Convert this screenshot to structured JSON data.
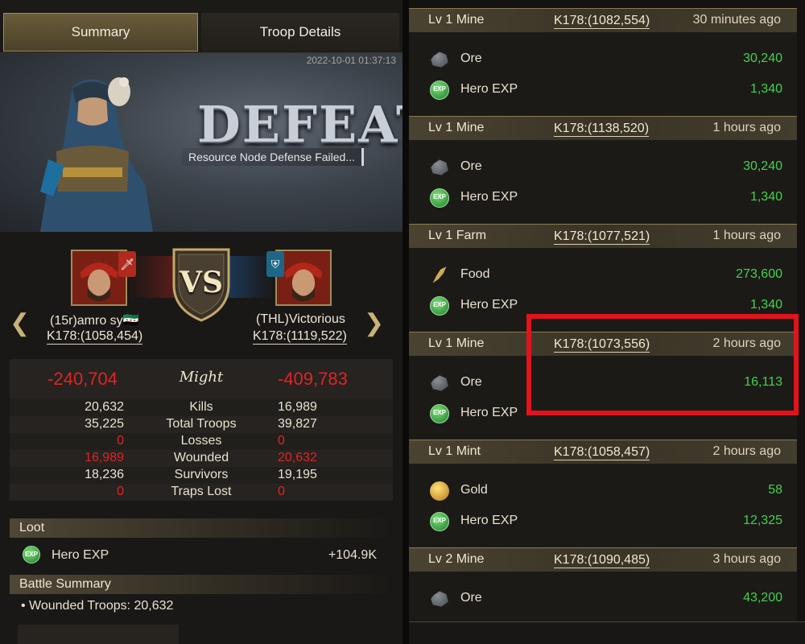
{
  "left": {
    "tabs": {
      "summary": "Summary",
      "troop_details": "Troop Details"
    },
    "timestamp": "2022-10-01 01:37:13",
    "banner": {
      "title": "DEFEAT",
      "subtitle": "Resource Node Defense Failed..."
    },
    "vs_label": "VS",
    "attacker": {
      "name": "(15r)amro sy🇸🇾",
      "coords": "K178:(1058,454)"
    },
    "defender": {
      "name": "(THL)Victorious",
      "coords": "K178:(1119,522)"
    },
    "might": {
      "label": "Might",
      "left": "-240,704",
      "right": "-409,783"
    },
    "stats": [
      {
        "label": "Kills",
        "left": "20,632",
        "right": "16,989",
        "left_red": false,
        "right_red": false
      },
      {
        "label": "Total Troops",
        "left": "35,225",
        "right": "39,827",
        "left_red": false,
        "right_red": false
      },
      {
        "label": "Losses",
        "left": "0",
        "right": "0",
        "left_red": true,
        "right_red": true
      },
      {
        "label": "Wounded",
        "left": "16,989",
        "right": "20,632",
        "left_red": true,
        "right_red": true
      },
      {
        "label": "Survivors",
        "left": "18,236",
        "right": "19,195",
        "left_red": false,
        "right_red": false
      },
      {
        "label": "Traps Lost",
        "left": "0",
        "right": "0",
        "left_red": true,
        "right_red": true
      }
    ],
    "loot": {
      "header": "Loot",
      "item_label": "Hero EXP",
      "item_value": "+104.9K"
    },
    "battle_summary": {
      "header": "Battle Summary",
      "line": "Wounded Troops: 20,632"
    }
  },
  "right": {
    "reports": [
      {
        "title": "Lv 1 Mine",
        "coords": "K178:(1082,554)",
        "time": "30 minutes ago",
        "items": [
          {
            "icon": "ore-icon",
            "label": "Ore",
            "value": "30,240"
          },
          {
            "icon": "hero-exp-icon",
            "label": "Hero EXP",
            "value": "1,340"
          }
        ]
      },
      {
        "title": "Lv 1 Mine",
        "coords": "K178:(1138,520)",
        "time": "1 hours ago",
        "items": [
          {
            "icon": "ore-icon",
            "label": "Ore",
            "value": "30,240"
          },
          {
            "icon": "hero-exp-icon",
            "label": "Hero EXP",
            "value": "1,340"
          }
        ]
      },
      {
        "title": "Lv 1 Farm",
        "coords": "K178:(1077,521)",
        "time": "1 hours ago",
        "items": [
          {
            "icon": "food-icon",
            "label": "Food",
            "value": "273,600"
          },
          {
            "icon": "hero-exp-icon",
            "label": "Hero EXP",
            "value": "1,340"
          }
        ]
      },
      {
        "title": "Lv 1 Mine",
        "coords": "K178:(1073,556)",
        "time": "2 hours ago",
        "items": [
          {
            "icon": "ore-icon",
            "label": "Ore",
            "value": "16,113"
          },
          {
            "icon": "hero-exp-icon",
            "label": "Hero EXP",
            "value": ""
          }
        ]
      },
      {
        "title": "Lv 1 Mint",
        "coords": "K178:(1058,457)",
        "time": "2 hours ago",
        "items": [
          {
            "icon": "gold-icon",
            "label": "Gold",
            "value": "58"
          },
          {
            "icon": "hero-exp-icon",
            "label": "Hero EXP",
            "value": "12,325"
          }
        ]
      },
      {
        "title": "Lv 2 Mine",
        "coords": "K178:(1090,485)",
        "time": "3 hours ago",
        "items": [
          {
            "icon": "ore-icon",
            "label": "Ore",
            "value": "43,200"
          }
        ]
      }
    ],
    "highlight_color": "#e0141c",
    "value_color": "#3fd44a"
  }
}
